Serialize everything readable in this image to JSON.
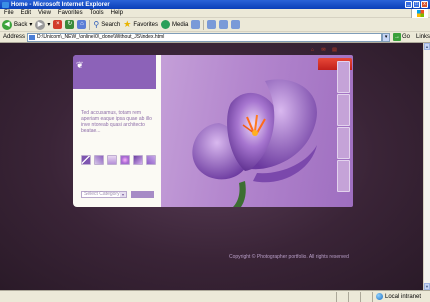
{
  "window": {
    "title": "Home - Microsoft Internet Explorer",
    "controls": [
      "_",
      "□",
      "x"
    ]
  },
  "menu": [
    "File",
    "Edit",
    "View",
    "Favorites",
    "Tools",
    "Help"
  ],
  "toolbar": {
    "back_label": "Back",
    "search_label": "Search",
    "favorites_label": "Favorites",
    "media_label": "Media"
  },
  "address": {
    "label": "Address",
    "url": "D:\\Unicom\\_NEW_\\online\\0\\_done\\Without_JS\\index.html",
    "go_label": "Go",
    "links_label": "Links"
  },
  "site": {
    "intro_text": "Ted accusamus, totam rem aperiam eaque ipsa quae ab illo inve ntoreab quasi architecto beatae...",
    "select_placeholder": "Select Category",
    "copyright": "Copyright © Photographer portfolio.  All rights reserved"
  },
  "status": {
    "zone": "Local intranet"
  }
}
